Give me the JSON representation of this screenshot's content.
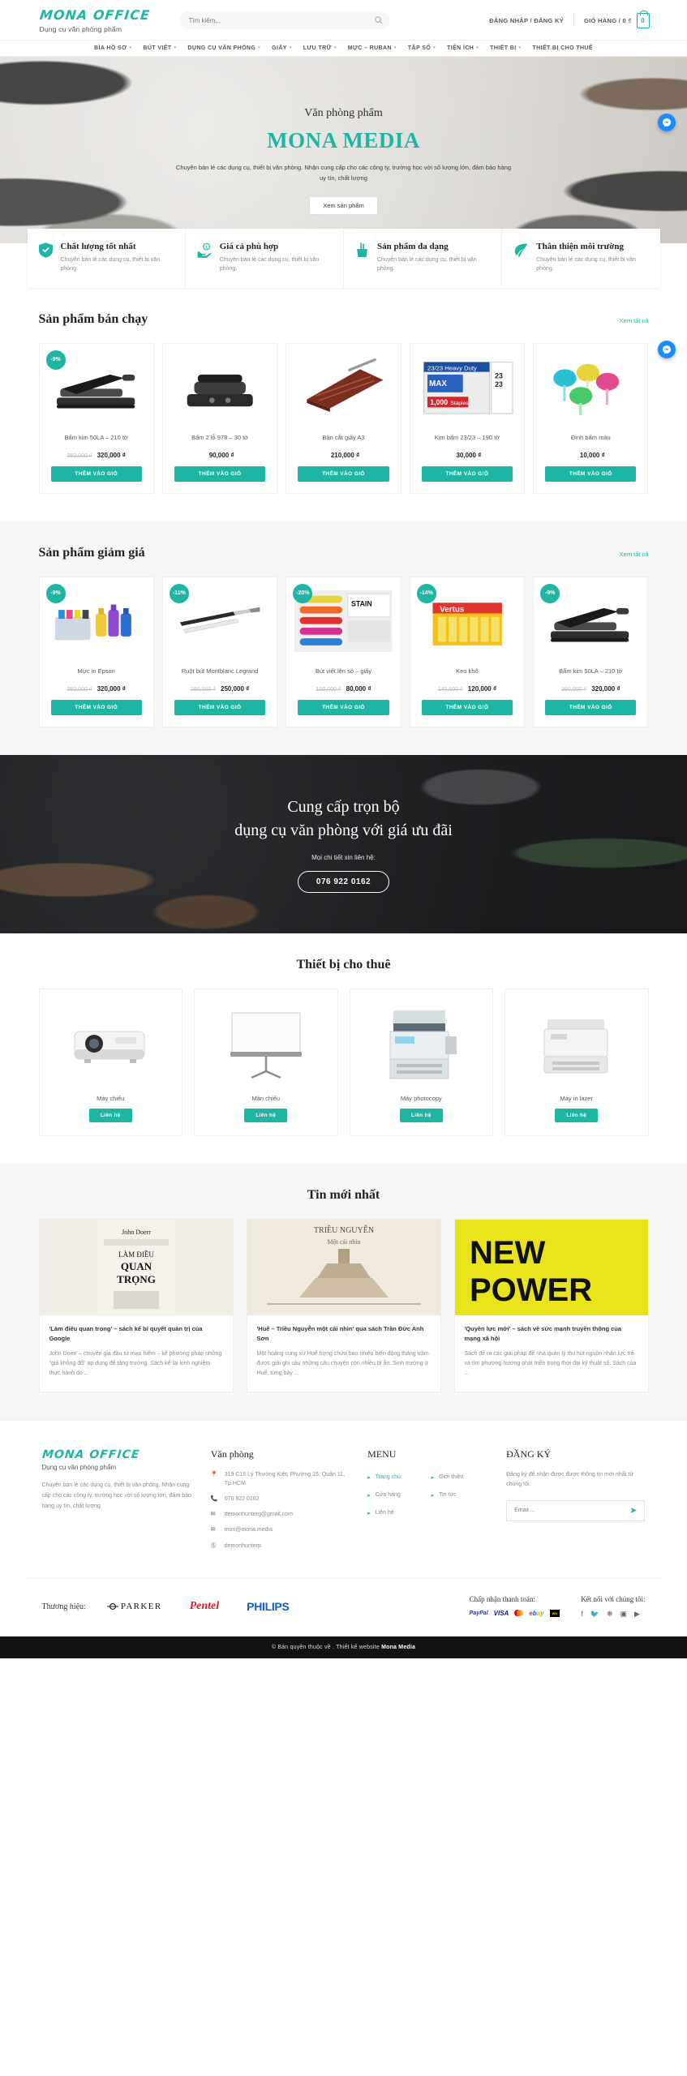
{
  "header": {
    "logo": "MONA OFFICE",
    "logo_sub": "Dụng cụ văn phòng phẩm",
    "search_placeholder": "Tìm kiếm...",
    "search_icon": "search-icon",
    "account_link": "ĐĂNG NHẬP / ĐĂNG KÝ",
    "cart_label": "GIỎ HÀNG / 0 ₫",
    "cart_count": "0"
  },
  "nav": {
    "items": [
      {
        "label": "BÌA HỒ SƠ",
        "caret": "▾"
      },
      {
        "label": "BÚT VIẾT",
        "caret": "▾"
      },
      {
        "label": "DỤNG CỤ VĂN PHÒNG",
        "caret": "▾"
      },
      {
        "label": "GIẤY",
        "caret": "▾"
      },
      {
        "label": "LƯU TRỮ",
        "caret": "▾"
      },
      {
        "label": "MỰC – RUBAN",
        "caret": "▾"
      },
      {
        "label": "TẬP SỐ",
        "caret": "▾"
      },
      {
        "label": "TIỆN ÍCH",
        "caret": "▾"
      },
      {
        "label": "THIẾT BỊ",
        "caret": "▾"
      },
      {
        "label": "THIẾT BỊ CHO THUÊ",
        "caret": ""
      }
    ]
  },
  "hero": {
    "eyebrow": "Văn phòng phẩm",
    "title": "MONA MEDIA",
    "description": "Chuyên bán lẻ các dụng cụ, thiết bị văn phòng. Nhận cung cấp cho các công ty, trường học với số lượng lớn, đảm bảo hàng uy tín, chất lượng",
    "button": "Xem sản phẩm"
  },
  "features": [
    {
      "icon": "shield-check-icon",
      "title": "Chất lượng tốt nhất",
      "text": "Chuyên bán lẻ các dụng cụ, thiết bị văn phòng."
    },
    {
      "icon": "hand-coin-icon",
      "title": "Giá cả phù hợp",
      "text": "Chuyên bán lẻ các dụng cụ, thiết bị văn phòng."
    },
    {
      "icon": "pen-cup-icon",
      "title": "Sản phẩm đa dạng",
      "text": "Chuyên bán lẻ các dụng cụ, thiết bị văn phòng."
    },
    {
      "icon": "leaf-icon",
      "title": "Thân thiện môi trường",
      "text": "Chuyên bán lẻ các dụng cụ, thiết bị văn phòng."
    }
  ],
  "bestsellers": {
    "title": "Sản phẩm bán chạy",
    "more": "Xem tất cả",
    "add_to_cart": "THÊM VÀO GIỎ",
    "items": [
      {
        "badge": "-9%",
        "name": "Bấm kim 50LA – 210 tờ",
        "old_price": "350,000 ₫",
        "price": "320,000 ₫"
      },
      {
        "badge": "",
        "name": "Bấm 2 lỗ 978 – 30 tờ",
        "old_price": "",
        "price": "90,000 ₫"
      },
      {
        "badge": "",
        "name": "Bàn cắt giấy A3",
        "old_price": "",
        "price": "210,000 ₫"
      },
      {
        "badge": "",
        "name": "Kim bấm 23/23 – 190 tờ",
        "old_price": "",
        "price": "30,000 ₫"
      },
      {
        "badge": "",
        "name": "Đinh bấm màu",
        "old_price": "",
        "price": "10,000 ₫"
      }
    ]
  },
  "sale": {
    "title": "Sản phẩm giảm giá",
    "more": "Xem tất cả",
    "add_to_cart": "THÊM VÀO GIỎ",
    "items": [
      {
        "badge": "-9%",
        "name": "Mực in Epson",
        "old_price": "350,000 ₫",
        "price": "320,000 ₫"
      },
      {
        "badge": "-11%",
        "name": "Ruột bút Montblanc Legrand",
        "old_price": "280,000 ₫",
        "price": "250,000 ₫"
      },
      {
        "badge": "-20%",
        "name": "Bút viết lên sỏ – giấy",
        "old_price": "100,000 ₫",
        "price": "80,000 ₫"
      },
      {
        "badge": "-14%",
        "name": "Keo khô",
        "old_price": "140,000 ₫",
        "price": "120,000 ₫"
      },
      {
        "badge": "-9%",
        "name": "Bấm kim 50LA – 210 tờ",
        "old_price": "350,000 ₫",
        "price": "320,000 ₫"
      }
    ]
  },
  "cta": {
    "line1": "Cung cấp trọn bộ",
    "line2": "dụng cụ văn phòng với giá ưu đãi",
    "note": "Mọi chi tiết xin liên hệ:",
    "phone": "076 922 0162"
  },
  "rental": {
    "title": "Thiết bị cho thuê",
    "contact_label": "Liên hệ",
    "items": [
      {
        "name": "Máy chiếu",
        "icon": "projector-icon"
      },
      {
        "name": "Màn chiếu",
        "icon": "projector-screen-icon"
      },
      {
        "name": "Máy photocopy",
        "icon": "photocopier-icon"
      },
      {
        "name": "Máy in lazer",
        "icon": "laser-printer-icon"
      }
    ]
  },
  "news": {
    "title": "Tin mới nhất",
    "items": [
      {
        "cover_title": "LÀM ĐIỀU QUAN TRỌNG",
        "cover_author": "John Doerr",
        "title": "'Làm điều quan trọng' – sách kể bí quyết quản trị của Google",
        "excerpt": "John Doerr – chuyên gia đầu tư mạo hiểm – kể phương pháp những \"giá không đổ\" áp dụng để tăng trưởng. Sách kể lại kinh nghiệm thực hành do ..."
      },
      {
        "cover_title": "TRIỀU NGUYỄN",
        "cover_sub": "Một cái nhìn",
        "title": "'Huế – Triều Nguyễn một cái nhìn' qua sách Trần Đức Anh Sơn",
        "excerpt": "Một hoàng cung xứ Huế hưng chứa bao nhiêu biến động thăng trầm được giải ghi sâu những câu chuyện còn nhiều bí ẩn. Sinh trưởng ở Huế, từng bày ..."
      },
      {
        "cover_title": "NEW POWER",
        "title": "'Quyền lực mới' – sách về sức mạnh truyền thông của mạng xã hội",
        "excerpt": "Sách đề ra các giải pháp để nhà quản lý thu hút nguồn nhân lực trẻ và tìm phương hướng phát triển trong thời đại kỹ thuật số. Sách của ..."
      }
    ]
  },
  "footer": {
    "logo": "MONA OFFICE",
    "logo_sub": "Dụng cụ văn phòng phẩm",
    "about": "Chuyên bán lẻ các dụng cụ, thiết bị văn phòng. Nhận cung cấp cho các công ty, trường học với số lượng lớn, đảm bảo hàng uy tín, chất lượng",
    "office": {
      "heading": "Văn phòng",
      "rows": [
        {
          "icon": "map-pin-icon",
          "text": "319 C16 Lý Thường Kiệt, Phường 15, Quận 11, Tp.HCM"
        },
        {
          "icon": "phone-icon",
          "text": "076 922 0162"
        },
        {
          "icon": "mail-icon",
          "text": "demonhunterg@gmail.com"
        },
        {
          "icon": "mail-icon",
          "text": "mon@mona.media"
        },
        {
          "icon": "skype-icon",
          "text": "demonhunterp"
        }
      ]
    },
    "menu": {
      "heading": "MENU",
      "items": [
        {
          "label": "Trang chủ",
          "active": true
        },
        {
          "label": "Giới thiệu",
          "active": false
        },
        {
          "label": "Cửa hàng",
          "active": false
        },
        {
          "label": "Tin tức",
          "active": false
        },
        {
          "label": "Liên hệ",
          "active": false
        }
      ]
    },
    "subscribe": {
      "heading": "ĐĂNG KÝ",
      "text": "Đăng ký để nhận được được thông tin mới nhất từ chúng tôi.",
      "placeholder": "Email ...",
      "send_icon": "send-icon"
    },
    "brands_label": "Thương hiệu:",
    "brands": [
      "PARKER",
      "Pentel",
      "PHILIPS"
    ],
    "payment_label": "Chấp nhận thanh toán:",
    "payments": [
      "PayPal",
      "VISA",
      "MasterCard",
      "ebay",
      "Western Union"
    ],
    "social_label": "Kết nối với chúng tôi:",
    "socials": [
      "facebook-icon",
      "twitter-icon",
      "rss-icon",
      "instagram-icon",
      "youtube-icon"
    ],
    "copyright_pre": "© Bản quyền thuộc về . Thiết kế website",
    "copyright_brand": "Mona Media"
  },
  "colors": {
    "accent": "#1fb5a3",
    "dark": "#121212",
    "messenger": "#1a8cff"
  }
}
